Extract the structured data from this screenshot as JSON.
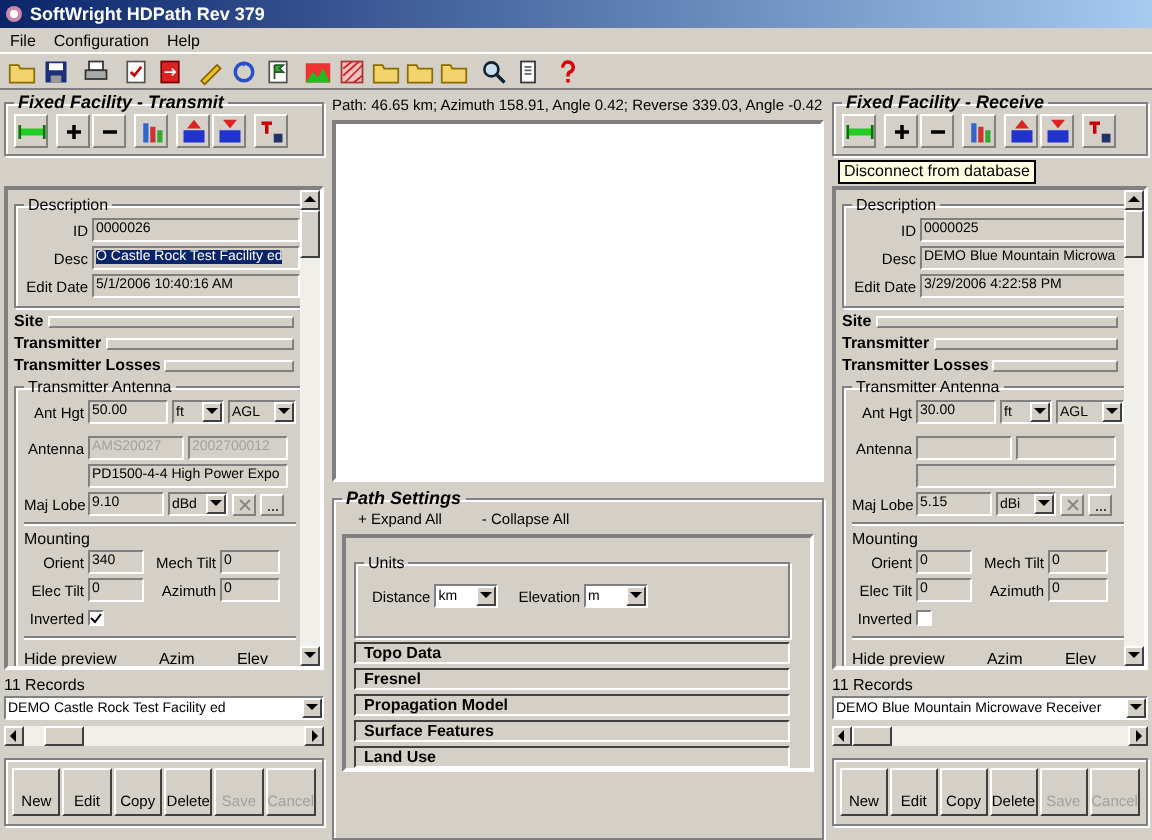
{
  "window": {
    "title": "SoftWright HDPath Rev 379"
  },
  "menu": [
    {
      "label": "File"
    },
    {
      "label": "Configuration"
    },
    {
      "label": "Help"
    }
  ],
  "facilities": [
    {
      "title": "Fixed Facility - Transmit",
      "description": {
        "legend": "Description",
        "fields": [
          {
            "label": "ID",
            "value": "0000026",
            "selected": false
          },
          {
            "label": "Desc",
            "value": "O Castle Rock Test Facility ed",
            "selected": true
          },
          {
            "label": "Edit Date",
            "value": "5/1/2006 10:40:16 AM",
            "selected": false
          }
        ]
      },
      "sections": [
        "Site",
        "Transmitter",
        "Transmitter Losses"
      ],
      "antenna": {
        "legend": "Transmitter Antenna",
        "ant_hgt": {
          "label": "Ant Hgt",
          "value": "50.00",
          "unit": "ft",
          "reference": "AGL"
        },
        "antenna": {
          "label": "Antenna",
          "code_1": "AMS20027",
          "code_2": "2002700012",
          "description": "PD1500-4-4 High Power Expo",
          "disabled": true
        },
        "maj_lobe": {
          "label": "Maj Lobe",
          "value": "9.10",
          "unit": "dBd"
        }
      },
      "mounting": {
        "legend": "Mounting",
        "fields": [
          {
            "label": "Orient",
            "value": "340"
          },
          {
            "label": "Mech Tilt",
            "value": "0"
          },
          {
            "label": "Elec Tilt",
            "value": "0"
          },
          {
            "label": "Azimuth",
            "value": "0"
          }
        ],
        "inverted": {
          "label": "Inverted",
          "checked": true
        }
      },
      "preview": {
        "hide_label": "Hide preview",
        "azim_label": "Azim",
        "elev_label": "Elev"
      },
      "records": {
        "count": "11 Records",
        "current": "DEMO Castle Rock Test Facility ed"
      },
      "buttons": [
        {
          "label": "New",
          "disabled": false
        },
        {
          "label": "Edit",
          "disabled": false
        },
        {
          "label": "Copy",
          "disabled": false
        },
        {
          "label": "Delete",
          "disabled": false
        },
        {
          "label": "Save",
          "disabled": true
        },
        {
          "label": "Cancel",
          "disabled": true
        }
      ]
    },
    {
      "title": "Fixed Facility - Receive",
      "tooltip": "Disconnect from database",
      "description": {
        "legend": "Description",
        "fields": [
          {
            "label": "ID",
            "value": "0000025",
            "selected": false
          },
          {
            "label": "Desc",
            "value": "DEMO Blue Mountain Microwa",
            "selected": false
          },
          {
            "label": "Edit Date",
            "value": "3/29/2006 4:22:58 PM",
            "selected": false
          }
        ]
      },
      "sections": [
        "Site",
        "Transmitter",
        "Transmitter Losses"
      ],
      "antenna": {
        "legend": "Transmitter Antenna",
        "ant_hgt": {
          "label": "Ant Hgt",
          "value": "30.00",
          "unit": "ft",
          "reference": "AGL"
        },
        "antenna": {
          "label": "Antenna"
        },
        "maj_lobe": {
          "label": "Maj Lobe",
          "value": "5.15",
          "unit": "dBi"
        }
      },
      "mounting": {
        "legend": "Mounting",
        "fields": [
          {
            "label": "Orient",
            "value": "0"
          },
          {
            "label": "Mech Tilt",
            "value": "0"
          },
          {
            "label": "Elec Tilt",
            "value": "0"
          },
          {
            "label": "Azimuth",
            "value": "0"
          }
        ],
        "inverted": {
          "label": "Inverted",
          "checked": false
        }
      },
      "preview": {
        "hide_label": "Hide preview",
        "azim_label": "Azim",
        "elev_label": "Elev"
      },
      "records": {
        "count": "11 Records",
        "current": "DEMO Blue Mountain Microwave Receiver"
      },
      "buttons": [
        {
          "label": "New",
          "disabled": false
        },
        {
          "label": "Edit",
          "disabled": false
        },
        {
          "label": "Copy",
          "disabled": false
        },
        {
          "label": "Delete",
          "disabled": false
        },
        {
          "label": "Save",
          "disabled": true
        },
        {
          "label": "Cancel",
          "disabled": true
        }
      ]
    }
  ],
  "path_info": "Path: 46.65 km; Azimuth 158.91, Angle 0.42; Reverse 339.03, Angle -0.42",
  "path_settings": {
    "title": "Path Settings",
    "links": [
      "+ Expand All",
      "- Collapse All"
    ],
    "units": {
      "legend": "Units",
      "distance_label": "Distance",
      "distance_value": "km",
      "elevation_label": "Elevation",
      "elevation_value": "m"
    },
    "sections": [
      "Topo Data",
      "Fresnel",
      "Propagation Model",
      "Surface Features",
      "Land Use"
    ]
  }
}
